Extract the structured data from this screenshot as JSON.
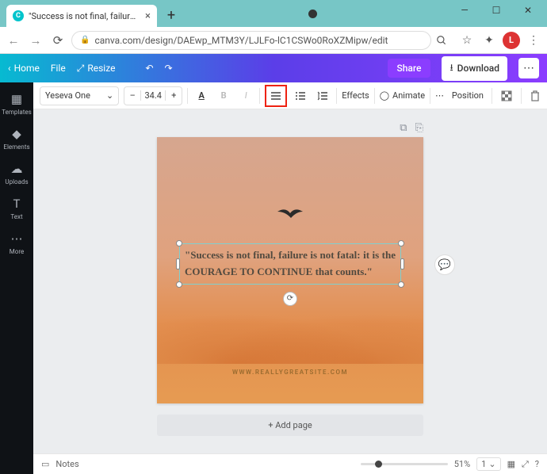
{
  "browser": {
    "tab_title": "\"Success is not final, failure is not…",
    "url": "canva.com/design/DAEwp_MTM3Y/LJLFo-lC1CSWo0RoXZMipw/edit",
    "avatar_initial": "L"
  },
  "app_bar": {
    "home": "Home",
    "file": "File",
    "resize": "Resize",
    "share": "Share",
    "download": "Download"
  },
  "sidebar": {
    "items": [
      {
        "label": "Templates"
      },
      {
        "label": "Elements"
      },
      {
        "label": "Uploads"
      },
      {
        "label": "Text"
      },
      {
        "label": "More"
      }
    ]
  },
  "toolbar": {
    "font": "Yeseva One",
    "size": "34.4",
    "effects": "Effects",
    "animate": "Animate",
    "position": "Position"
  },
  "canvas": {
    "quote": "\"Success is not final, failure is not fatal: it is the COURAGE TO CONTINUE that counts.\"",
    "site": "WWW.REALLYGREATSITE.COM",
    "add_page": "+ Add page"
  },
  "footer": {
    "notes": "Notes",
    "zoom": "51%",
    "page": "1"
  }
}
